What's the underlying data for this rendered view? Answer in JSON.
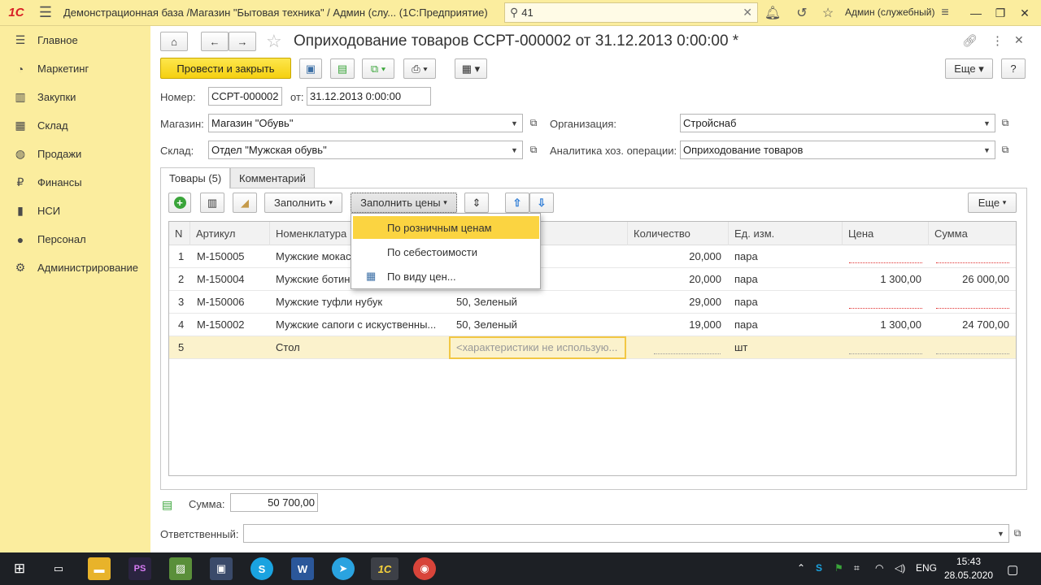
{
  "topbar": {
    "title": "Демонстрационная база /Магазин \"Бытовая техника\" / Админ (слу...  (1С:Предприятие)",
    "search_value": "41",
    "user": "Админ (служебный)"
  },
  "sidebar": {
    "items": [
      {
        "label": "Главное",
        "icon": "menu-lines-icon"
      },
      {
        "label": "Маркетинг",
        "icon": "pie-chart-icon"
      },
      {
        "label": "Закупки",
        "icon": "barcode-icon"
      },
      {
        "label": "Склад",
        "icon": "grid-icon"
      },
      {
        "label": "Продажи",
        "icon": "basket-icon"
      },
      {
        "label": "Финансы",
        "icon": "ruble-icon"
      },
      {
        "label": "НСИ",
        "icon": "book-icon"
      },
      {
        "label": "Персонал",
        "icon": "person-icon"
      },
      {
        "label": "Администрирование",
        "icon": "gear-icon"
      }
    ]
  },
  "document": {
    "title": "Оприходование товаров ССРТ-000002 от 31.12.2013 0:00:00 *",
    "post_close_label": "Провести и закрыть",
    "more_label": "Еще",
    "help_label": "?",
    "number_label": "Номер:",
    "number_value": "ССРТ-000002",
    "date_label": "от:",
    "date_value": "31.12.2013  0:00:00",
    "store_label": "Магазин:",
    "store_value": "Магазин \"Обувь\"",
    "org_label": "Организация:",
    "org_value": "Стройснаб",
    "warehouse_label": "Склад:",
    "warehouse_value": "Отдел \"Мужская обувь\"",
    "analytics_label": "Аналитика хоз. операции:",
    "analytics_value": "Оприходование товаров"
  },
  "tabs": [
    {
      "label": "Товары (5)"
    },
    {
      "label": "Комментарий"
    }
  ],
  "grid_toolbar": {
    "fill_label": "Заполнить",
    "fill_prices_label": "Заполнить цены",
    "more_label": "Еще"
  },
  "grid": {
    "columns": [
      "N",
      "Артикул",
      "Номенклатура",
      "Количество",
      "Ед. изм.",
      "Цена",
      "Сумма"
    ],
    "rows": [
      {
        "n": "1",
        "sku": "М-150005",
        "name": "Мужские мокас",
        "char": "",
        "qty": "20,000",
        "unit": "пара",
        "price": "",
        "sum": ""
      },
      {
        "n": "2",
        "sku": "М-150004",
        "name": "Мужские ботин",
        "char": "",
        "qty": "20,000",
        "unit": "пара",
        "price": "1 300,00",
        "sum": "26 000,00"
      },
      {
        "n": "3",
        "sku": "М-150006",
        "name": "Мужские туфли нубук",
        "char": "50, Зеленый",
        "qty": "29,000",
        "unit": "пара",
        "price": "",
        "sum": ""
      },
      {
        "n": "4",
        "sku": "М-150002",
        "name": "Мужские сапоги с искуственны...",
        "char": "50, Зеленый",
        "qty": "19,000",
        "unit": "пара",
        "price": "1 300,00",
        "sum": "24 700,00"
      },
      {
        "n": "5",
        "sku": "",
        "name": "Стол",
        "char": "<характеристики не использую...",
        "qty": "",
        "unit": "шт",
        "price": "",
        "sum": ""
      }
    ]
  },
  "popup": {
    "items": [
      "По розничным ценам",
      "По себестоимости",
      "По виду цен..."
    ]
  },
  "footer": {
    "sum_label": "Сумма:",
    "sum_value": "50 700,00",
    "responsible_label": "Ответственный:",
    "responsible_value": ""
  },
  "taskbar": {
    "lang": "ENG",
    "time": "15:43",
    "date": "28.05.2020"
  }
}
